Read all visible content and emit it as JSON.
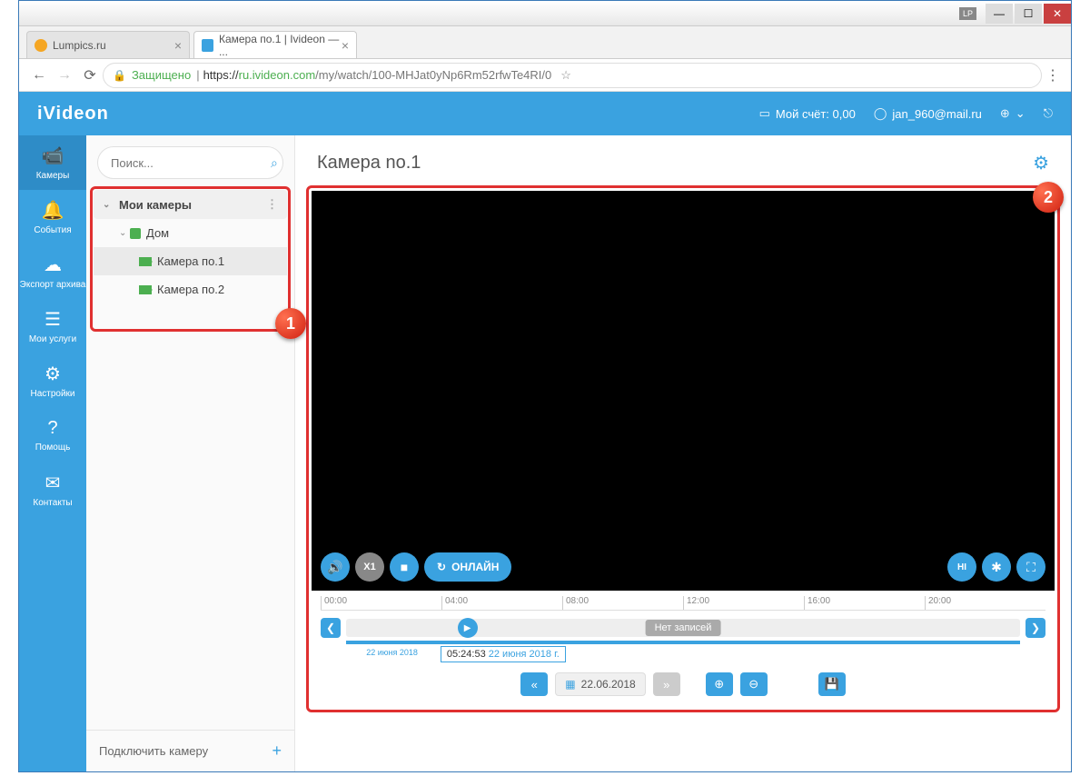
{
  "window": {
    "lp": "LP"
  },
  "tabs": [
    {
      "label": "Lumpics.ru",
      "favicon": "#f5a623"
    },
    {
      "label": "Камера по.1 | Ivideon — ...",
      "favicon": "#3aa2e0"
    }
  ],
  "addressbar": {
    "secure_label": "Защищено",
    "protocol": "https://",
    "domain": "ru.ivideon.com",
    "path": "/my/watch/100-MHJat0yNp6Rm52rfwTe4RI/0"
  },
  "header": {
    "logo": "iVideon",
    "balance_label": "Мой счёт: 0,00",
    "user_email": "jan_960@mail.ru"
  },
  "nav": {
    "cameras": "Камеры",
    "events": "События",
    "export": "Экспорт архива",
    "services": "Мои услуги",
    "settings": "Настройки",
    "help": "Помощь",
    "contacts": "Контакты"
  },
  "sidebar": {
    "search_placeholder": "Поиск...",
    "tree": {
      "root": "Мои камеры",
      "server": "Дом",
      "cam1": "Камера по.1",
      "cam2": "Камера по.2"
    },
    "connect": "Подключить камеру"
  },
  "main": {
    "title": "Камера no.1",
    "speed": "X1",
    "online": "ОНЛАЙН",
    "hi": "HI"
  },
  "timeline": {
    "ticks": [
      "00:00",
      "04:00",
      "08:00",
      "12:00",
      "16:00",
      "20:00"
    ],
    "no_records": "Нет записей",
    "tooltip_time": "05:24:53",
    "tooltip_date": "22 июня 2018 г.",
    "date_label": "22 июня 2018"
  },
  "bottombar": {
    "date": "22.06.2018"
  },
  "badges": {
    "one": "1",
    "two": "2"
  }
}
